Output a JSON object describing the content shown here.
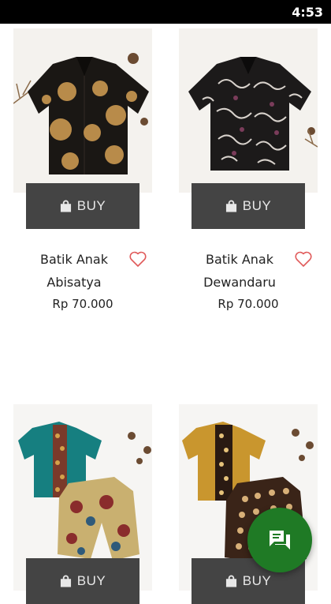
{
  "status_bar": {
    "time": "4:53"
  },
  "buy_label": "BUY",
  "products": [
    {
      "name_line1": "Batik Anak",
      "name_line2": "Abisatya",
      "price": "Rp 70.000",
      "image": "black shirt with gold circle batik motif"
    },
    {
      "name_line1": "Batik Anak",
      "name_line2": "Dewandaru",
      "price": "Rp 70.000",
      "image": "black and white leaf batik shirt"
    },
    {
      "name_line1": "",
      "name_line2": "",
      "price": "",
      "image": "teal shirt with floral batik shorts"
    },
    {
      "name_line1": "",
      "name_line2": "",
      "price": "",
      "image": "mustard shirt with brown batik shorts"
    }
  ],
  "icons": {
    "buy": "shopping-bag-icon",
    "favorite": "heart-outline-icon",
    "chat": "chat-forum-icon"
  },
  "colors": {
    "buy_button": "#444444",
    "heart": "#e05a5a",
    "fab": "#1f7a25"
  }
}
